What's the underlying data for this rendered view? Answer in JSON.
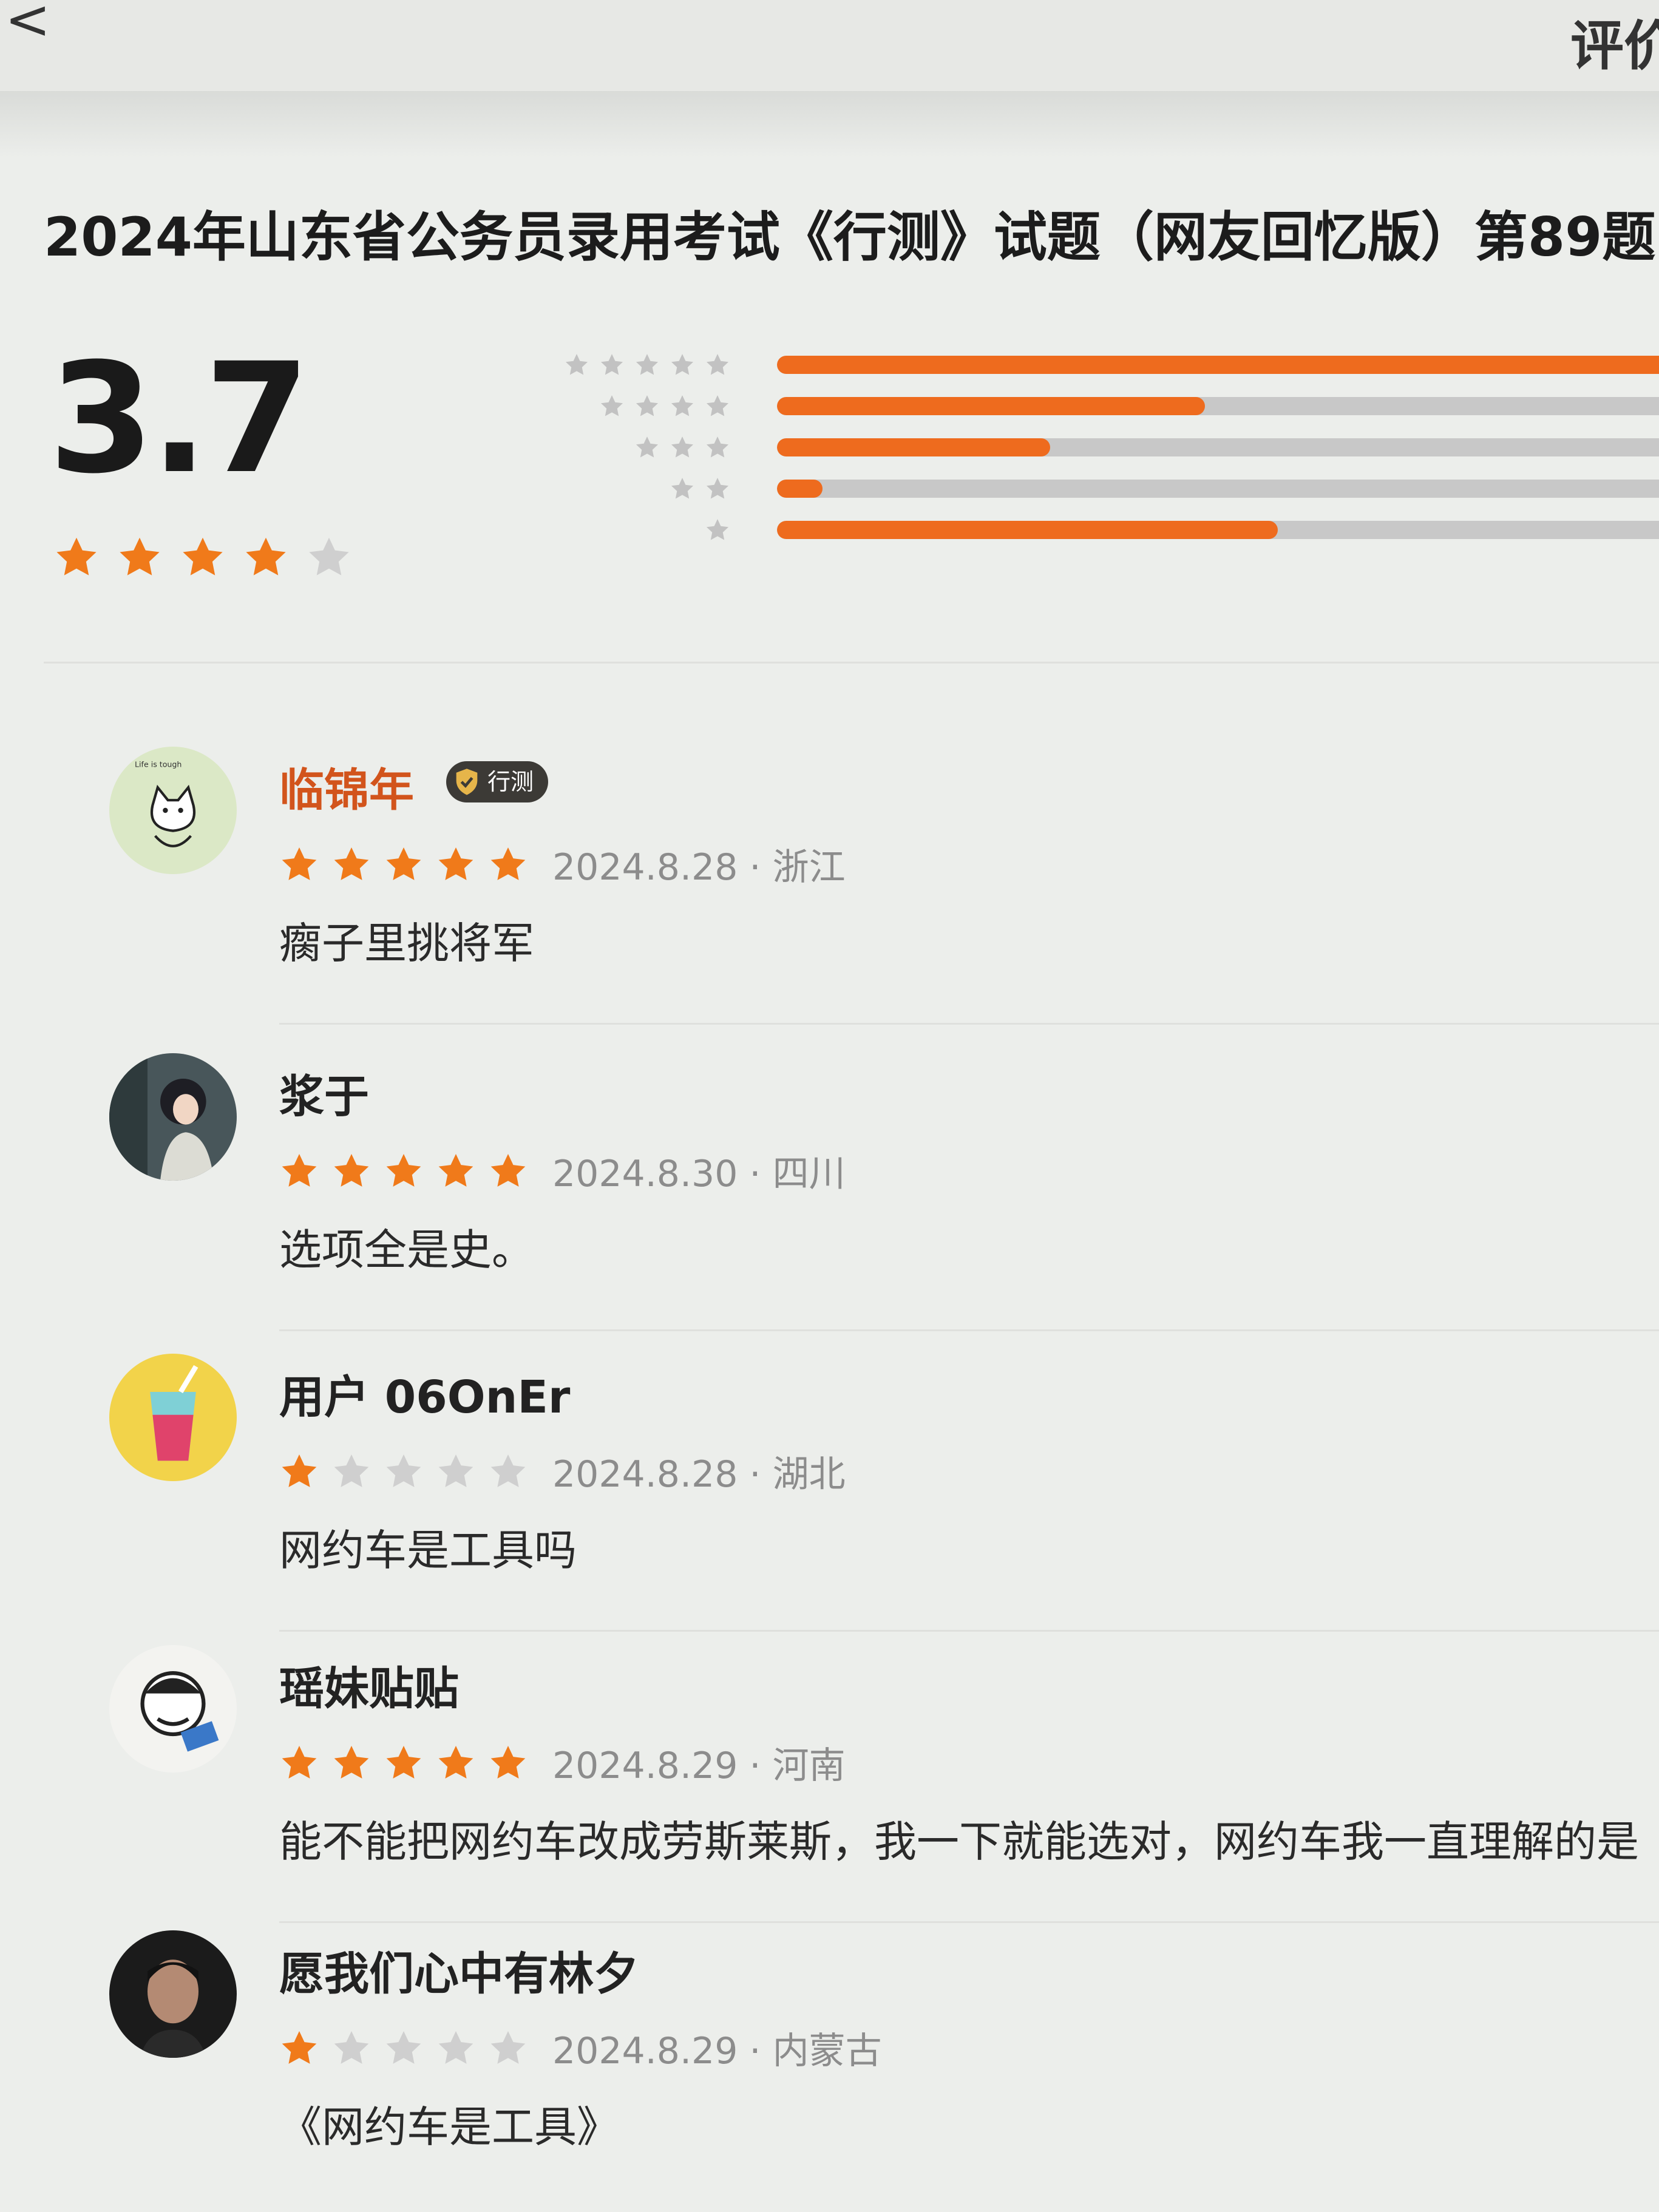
{
  "header": {
    "title": "评价"
  },
  "page": {
    "question_title": "2024年山东省公务员录用考试《行测》试题（网友回忆版）第89题"
  },
  "rating": {
    "score": "3.7",
    "stars_filled": 4,
    "stars_total": 5,
    "distribution": [
      {
        "stars": 5,
        "fraction": 1.0
      },
      {
        "stars": 4,
        "fraction": 0.47
      },
      {
        "stars": 3,
        "fraction": 0.3
      },
      {
        "stars": 2,
        "fraction": 0.05
      },
      {
        "stars": 1,
        "fraction": 0.55
      }
    ]
  },
  "colors": {
    "accent": "#ee6b1e",
    "star_on": "#f07a1a",
    "star_off": "#cfcfcf",
    "dist_star": "#c2c2c2",
    "name_highlight": "#d2541c"
  },
  "reviews": [
    {
      "name": "临锦年",
      "highlight": true,
      "badge": "行测",
      "stars": 5,
      "meta": "2024.8.28 · 浙江",
      "text": "瘸子里挑将军",
      "avatar": "cat-sticker"
    },
    {
      "name": "浆于",
      "highlight": false,
      "badge": "",
      "stars": 5,
      "meta": "2024.8.30 · 四川",
      "text": "选项全是史。",
      "avatar": "anime-girl"
    },
    {
      "name": "用户 06OnEr",
      "highlight": false,
      "badge": "",
      "stars": 1,
      "meta": "2024.8.28 · 湖北",
      "text": "网约车是工具吗",
      "avatar": "drink-cup"
    },
    {
      "name": "瑶妹贴贴",
      "highlight": false,
      "badge": "",
      "stars": 5,
      "meta": "2024.8.29 · 河南",
      "text": "能不能把网约车改成劳斯莱斯，我一下就能选对，网约车我一直理解的是",
      "avatar": "cartoon-doodle"
    },
    {
      "name": "愿我们心中有林夕",
      "highlight": false,
      "badge": "",
      "stars": 1,
      "meta": "2024.8.29 · 内蒙古",
      "text": "《网约车是工具》",
      "avatar": "man-photo"
    }
  ]
}
